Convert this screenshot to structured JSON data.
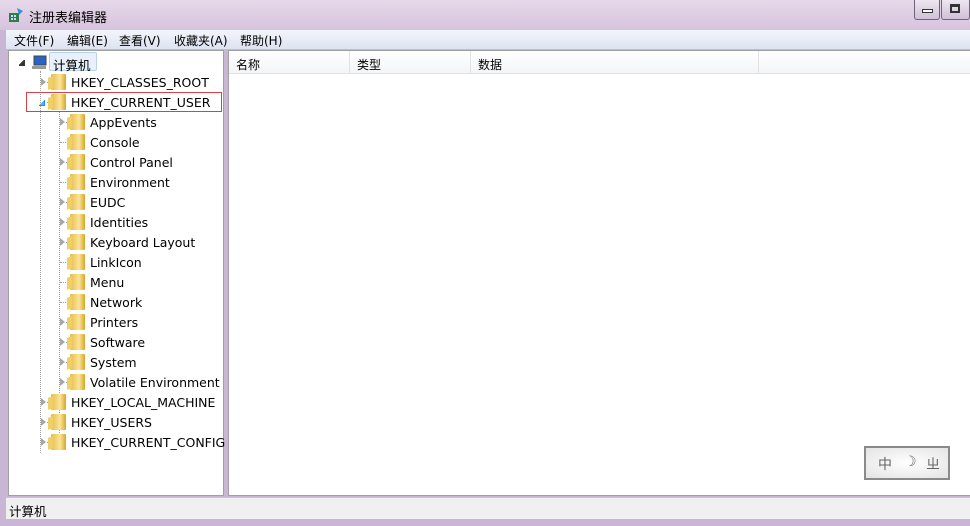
{
  "window": {
    "title": "注册表编辑器",
    "icon": "regedit-icon"
  },
  "menu": [
    "文件(F)",
    "编辑(E)",
    "查看(V)",
    "收藏夹(A)",
    "帮助(H)"
  ],
  "columns": [
    "名称",
    "类型",
    "数据"
  ],
  "tree": {
    "root": "计算机",
    "hives": [
      {
        "label": "HKEY_CLASSES_ROOT",
        "expandable": true
      },
      {
        "label": "HKEY_CURRENT_USER",
        "expanded": true,
        "selected": true,
        "children": [
          {
            "label": "AppEvents",
            "expandable": true
          },
          {
            "label": "Console",
            "expandable": false
          },
          {
            "label": "Control Panel",
            "expandable": true
          },
          {
            "label": "Environment",
            "expandable": false
          },
          {
            "label": "EUDC",
            "expandable": true
          },
          {
            "label": "Identities",
            "expandable": true
          },
          {
            "label": "Keyboard Layout",
            "expandable": true
          },
          {
            "label": "LinkIcon",
            "expandable": false
          },
          {
            "label": "Menu",
            "expandable": false
          },
          {
            "label": "Network",
            "expandable": false
          },
          {
            "label": "Printers",
            "expandable": true
          },
          {
            "label": "Software",
            "expandable": true
          },
          {
            "label": "System",
            "expandable": true
          },
          {
            "label": "Volatile Environment",
            "expandable": true
          }
        ]
      },
      {
        "label": "HKEY_LOCAL_MACHINE",
        "expandable": true
      },
      {
        "label": "HKEY_USERS",
        "expandable": true
      },
      {
        "label": "HKEY_CURRENT_CONFIG",
        "expandable": true
      }
    ]
  },
  "status": "计算机",
  "ime": {
    "lang": "中",
    "mode": "☽",
    "punct": "ㄓ"
  },
  "colors": {
    "selection_border": "#d9414a",
    "title_bar": "#d6c3dd"
  }
}
